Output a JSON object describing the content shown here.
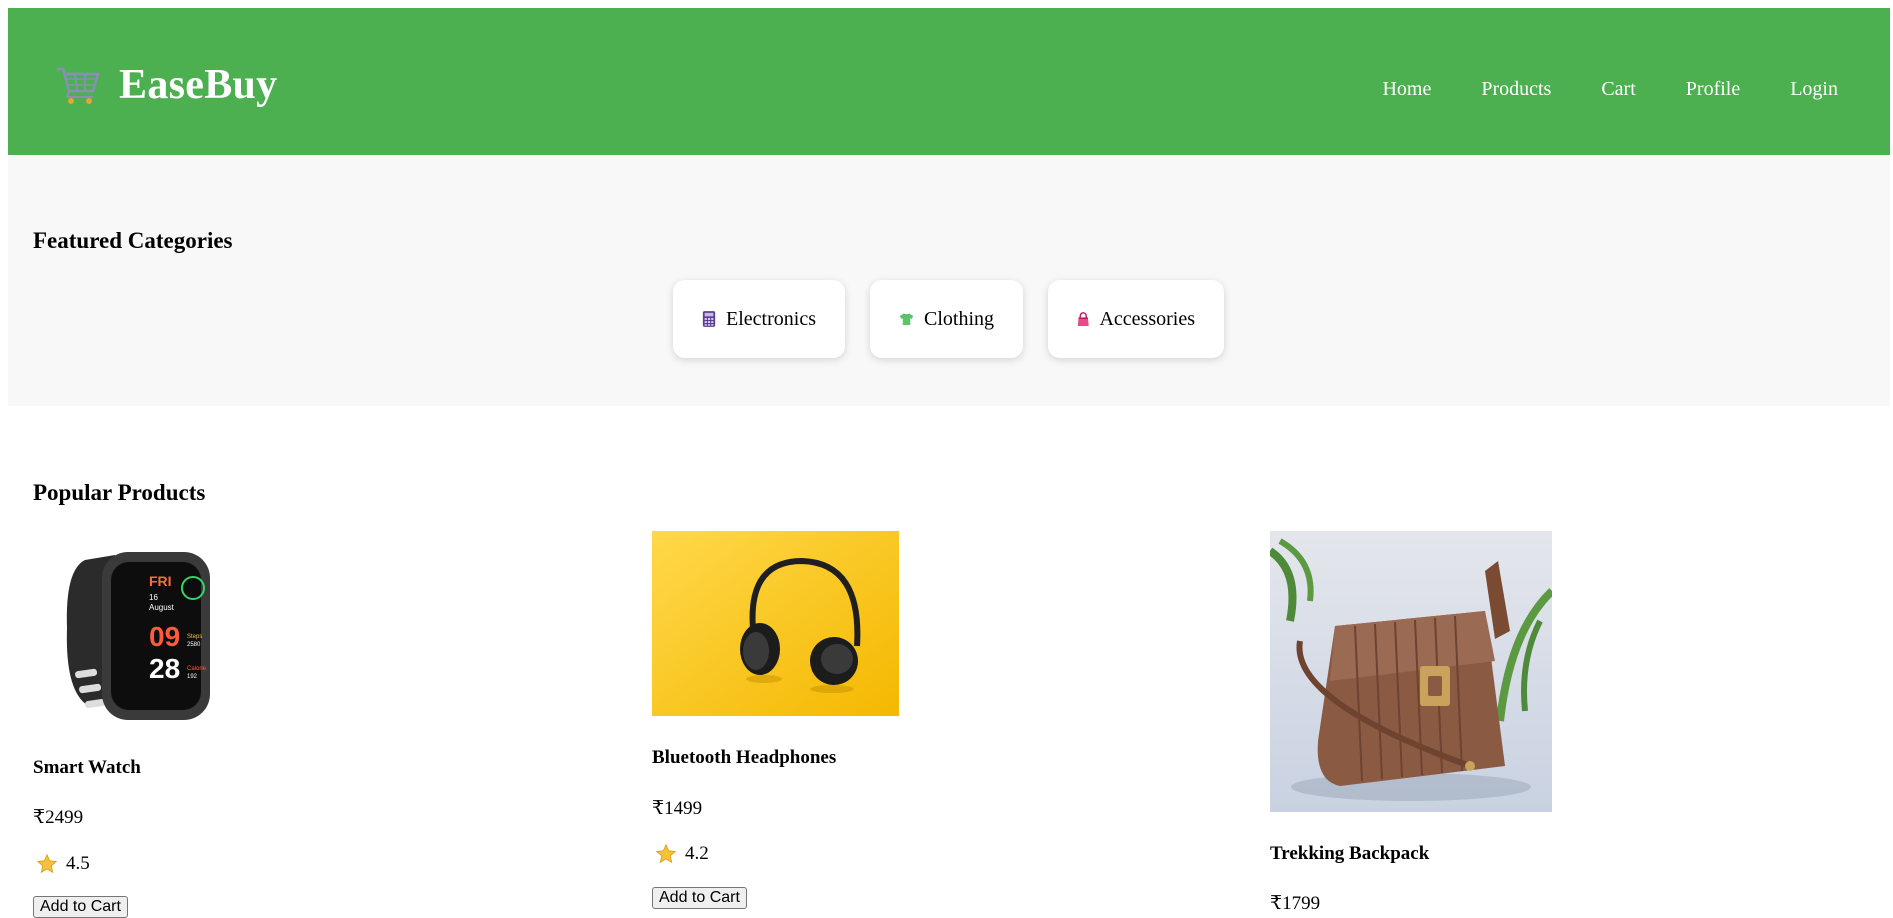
{
  "header": {
    "brand": "EaseBuy",
    "brand_icon": "shopping-cart-icon",
    "nav": [
      "Home",
      "Products",
      "Cart",
      "Profile",
      "Login"
    ]
  },
  "featured": {
    "title": "Featured Categories",
    "categories": [
      {
        "label": "Electronics",
        "icon": "calculator-icon"
      },
      {
        "label": "Clothing",
        "icon": "tshirt-icon"
      },
      {
        "label": "Accessories",
        "icon": "handbag-icon"
      }
    ]
  },
  "popular": {
    "title": "Popular Products",
    "products": [
      {
        "name": "Smart Watch",
        "price": "₹2499",
        "rating": "4.5",
        "button": "Add to Cart",
        "image": "smart-watch-image"
      },
      {
        "name": "Bluetooth Headphones",
        "price": "₹1499",
        "rating": "4.2",
        "button": "Add to Cart",
        "image": "headphones-image"
      },
      {
        "name": "Trekking Backpack",
        "price": "₹1799",
        "rating": "",
        "button": "",
        "image": "backpack-image"
      }
    ]
  },
  "colors": {
    "header": "#4caf50",
    "featured_bg": "#f8f8f8"
  }
}
